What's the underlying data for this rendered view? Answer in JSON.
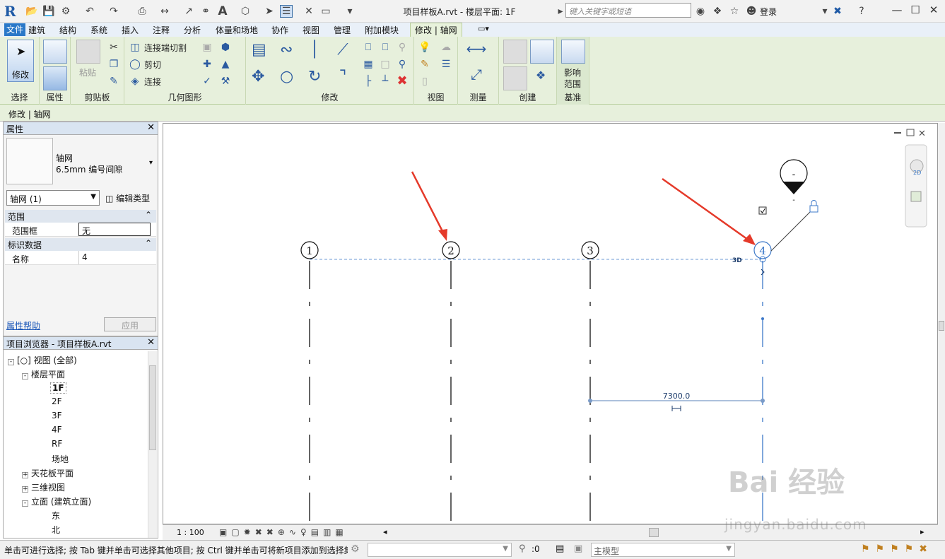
{
  "titlebar": {
    "title": "项目样板A.rvt - 楼层平面: 1F",
    "search_placeholder": "键入关键字或短语",
    "login": "登录"
  },
  "menu": {
    "file": "文件",
    "tabs": [
      "建筑",
      "结构",
      "系统",
      "插入",
      "注释",
      "分析",
      "体量和场地",
      "协作",
      "视图",
      "管理",
      "附加模块"
    ],
    "active_tab": "修改 | 轴网"
  },
  "ribbon": {
    "select_label": "选择",
    "modify_label": "修改",
    "properties_label": "属性",
    "clipboard_label": "剪贴板",
    "paste_label": "粘贴",
    "geometry_label": "几何图形",
    "join_cut": "连接端切割",
    "cut": "剪切",
    "join": "连接",
    "modify_panel_label": "修改",
    "view_label": "视图",
    "measure_label": "测量",
    "create_label": "创建",
    "datum_label": "基准",
    "scope_btn_1": "影响",
    "scope_btn_2": "范围"
  },
  "options_bar": {
    "text": "修改 | 轴网"
  },
  "properties": {
    "title": "属性",
    "type_name": "轴网",
    "type_sub": "6.5mm 编号间隙",
    "selector": "轴网 (1)",
    "edit_type": "编辑类型",
    "section_extents": "范围",
    "scope_box_key": "范围框",
    "scope_box_val": "无",
    "section_identity": "标识数据",
    "name_key": "名称",
    "name_val": "4",
    "help": "属性帮助",
    "apply": "应用"
  },
  "browser": {
    "title": "项目浏览器 - 项目样板A.rvt",
    "items": [
      {
        "label": "[○] 视图 (全部)",
        "level": 0,
        "exp": "-"
      },
      {
        "label": "楼层平面",
        "level": 1,
        "exp": "-"
      },
      {
        "label": "1F",
        "level": 2,
        "exp": ""
      },
      {
        "label": "2F",
        "level": 2,
        "exp": ""
      },
      {
        "label": "3F",
        "level": 2,
        "exp": ""
      },
      {
        "label": "4F",
        "level": 2,
        "exp": ""
      },
      {
        "label": "RF",
        "level": 2,
        "exp": ""
      },
      {
        "label": "场地",
        "level": 2,
        "exp": ""
      },
      {
        "label": "天花板平面",
        "level": 1,
        "exp": "+"
      },
      {
        "label": "三维视图",
        "level": 1,
        "exp": "+"
      },
      {
        "label": "立面 (建筑立面)",
        "level": 1,
        "exp": "-"
      },
      {
        "label": "东",
        "level": 2,
        "exp": ""
      },
      {
        "label": "北",
        "level": 2,
        "exp": ""
      }
    ]
  },
  "canvas": {
    "grid_labels": [
      "1",
      "2",
      "3",
      "4"
    ],
    "dimension": "7300.0",
    "tag_3d": "3D",
    "nav_2d": "2D",
    "elevation_mark": "-"
  },
  "viewbar": {
    "scale": "1 : 100"
  },
  "status": {
    "text": "单击可进行选择; 按 Tab 键并单击可选择其他项目; 按 Ctrl 键并单击可将新项目添加到选择集; 按 Shift 键并单击可取消选择。",
    "selection_count": ":0",
    "model": "主模型"
  },
  "watermark": {
    "brand": "Bai 经验",
    "url": "jingyan.baidu.com"
  },
  "colors": {
    "accent": "#2a78c8",
    "ribbon_bg": "#e7f0dc",
    "arrow": "#e53a2a",
    "selection": "#3c78c8"
  }
}
